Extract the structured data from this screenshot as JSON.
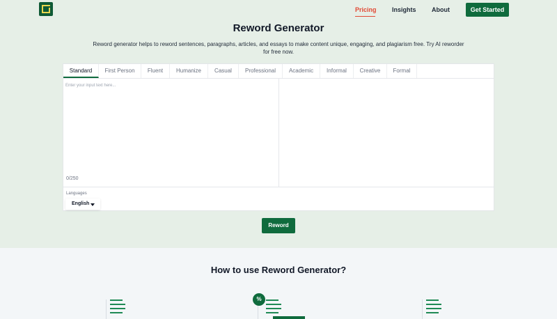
{
  "nav": {
    "links": [
      "Pricing",
      "Insights",
      "About"
    ],
    "cta": "Get Started"
  },
  "hero": {
    "title": "Reword Generator",
    "description": "Reword generator helps to reword sentences, paragraphs, articles, and essays to make content unique, engaging, and plagiarism free. Try AI reworder for free now."
  },
  "editor": {
    "tabs": [
      "Standard",
      "First Person",
      "Fluent",
      "Humanize",
      "Casual",
      "Professional",
      "Academic",
      "Informal",
      "Creative",
      "Formal"
    ],
    "input_placeholder": "Enter your input text here...",
    "counter": "0/250",
    "languages_label": "Languages",
    "language_selected": "English"
  },
  "actions": {
    "reword": "Reword"
  },
  "how": {
    "title": "How to use Reword Generator?"
  },
  "icons": {
    "badge": "%"
  },
  "colors": {
    "brand_green": "#0f6b3d",
    "accent_red": "#e24a35",
    "logo_yellow": "#e9d64f"
  }
}
